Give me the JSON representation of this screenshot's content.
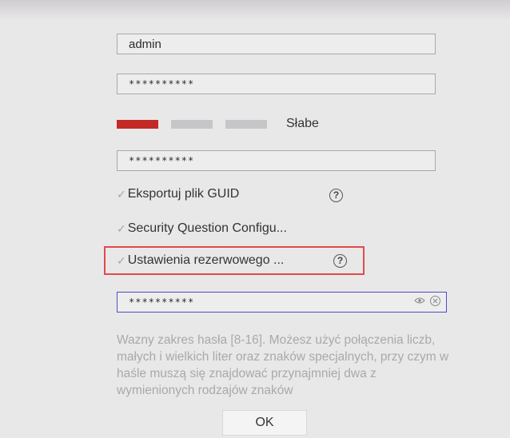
{
  "form": {
    "username": "admin",
    "password_masked": "**********",
    "confirm_masked": "**********",
    "strength_label": "Słabe",
    "colors": {
      "strength_weak": "#c42a25",
      "strength_empty": "#c6c5c8",
      "highlight": "#e04a4a"
    },
    "options": {
      "export_guid": "Eksportuj plik GUID",
      "security_question": "Security Question Configu...",
      "backup_settings": "Ustawienia rezerwowego ..."
    },
    "backup_password_masked": "**********",
    "hint": "Wazny zakres hasła [8-16]. Możesz użyć połączenia liczb, małych i wielkich liter oraz znaków specjalnych, przy czym w haśle muszą się znajdować przynajmniej dwa z wymienionych rodzajów znaków",
    "ok_label": "OK",
    "icons": {
      "check": "check-icon",
      "help": "help-icon",
      "show_password": "eye-icon",
      "clear": "clear-icon"
    }
  }
}
